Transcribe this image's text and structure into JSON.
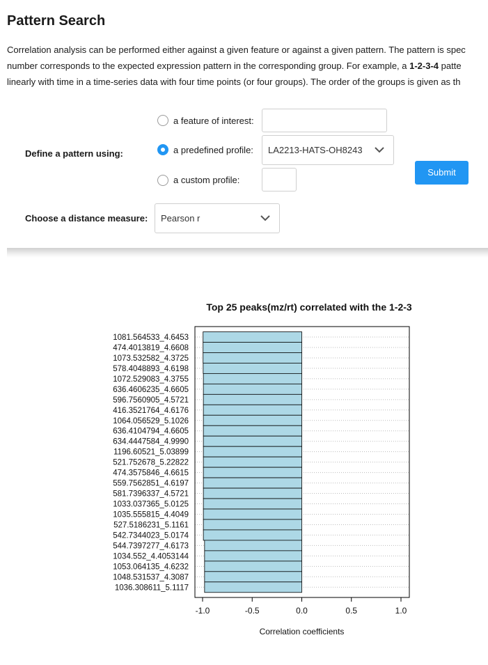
{
  "page": {
    "title": "Pattern Search",
    "intro_lines": [
      [
        {
          "t": "Correlation analysis can be performed either against a given feature or against a given pattern. The pattern is spec",
          "b": false
        }
      ],
      [
        {
          "t": "number corresponds to the expected expression pattern in the corresponding group. For example, a ",
          "b": false
        },
        {
          "t": "1-2-3-4",
          "b": true
        },
        {
          "t": " patte",
          "b": false
        }
      ],
      [
        {
          "t": "linearly with time in a time-series data with four time points (or four groups). The order of the groups is given as th",
          "b": false
        }
      ]
    ]
  },
  "form": {
    "define_label": "Define a pattern using:",
    "options": [
      {
        "label": "a feature of interest:",
        "checked": false,
        "value": ""
      },
      {
        "label": "a predefined profile:",
        "checked": true,
        "value": "LA2213-HATS-OH8243"
      },
      {
        "label": "a custom profile:",
        "checked": false,
        "value": ""
      }
    ],
    "distance_label": "Choose a distance measure:",
    "distance_value": "Pearson r",
    "submit_label": "Submit"
  },
  "chart_data": {
    "type": "bar",
    "orientation": "horizontal",
    "title": "Top 25 peaks(mz/rt) correlated with the 1-2-3",
    "xlabel": "Correlation coefficients",
    "ylabel": "",
    "xlim": [
      -1.0,
      1.0
    ],
    "xticks": [
      -1.0,
      -0.5,
      0.0,
      0.5,
      1.0
    ],
    "xtick_labels": [
      "-1.0",
      "-0.5",
      "0.0",
      "0.5",
      "1.0"
    ],
    "grid": "horizontal dotted",
    "bar_color": "#add8e6",
    "categories": [
      "1081.564533_4.6453",
      "474.4013819_4.6608",
      "1073.532582_4.3725",
      "578.4048893_4.6198",
      "1072.529083_4.3755",
      "636.4606235_4.6605",
      "596.7560905_4.5721",
      "416.3521764_4.6176",
      "1064.056529_5.1026",
      "636.4104794_4.6605",
      "634.4447584_4.9990",
      "1196.60521_5.03899",
      "521.752678_5.22822",
      "474.3575846_4.6615",
      "559.7562851_4.6197",
      "581.7396337_4.5721",
      "1033.037365_5.0125",
      "1035.555815_4.4049",
      "527.5186231_5.1161",
      "542.7344023_5.0174",
      "544.7397277_4.6173",
      "1034.552_4.4053144",
      "1053.064135_4.6232",
      "1048.531537_4.3087",
      "1036.308611_5.1117"
    ],
    "values": [
      -0.995,
      -0.995,
      -0.995,
      -0.994,
      -0.992,
      -0.992,
      -0.992,
      -0.992,
      -0.992,
      -0.992,
      -0.992,
      -0.992,
      -0.992,
      -0.992,
      -0.992,
      -0.992,
      -0.992,
      -0.992,
      -0.992,
      -0.992,
      -0.98,
      -0.98,
      -0.98,
      -0.98,
      -0.98
    ]
  }
}
